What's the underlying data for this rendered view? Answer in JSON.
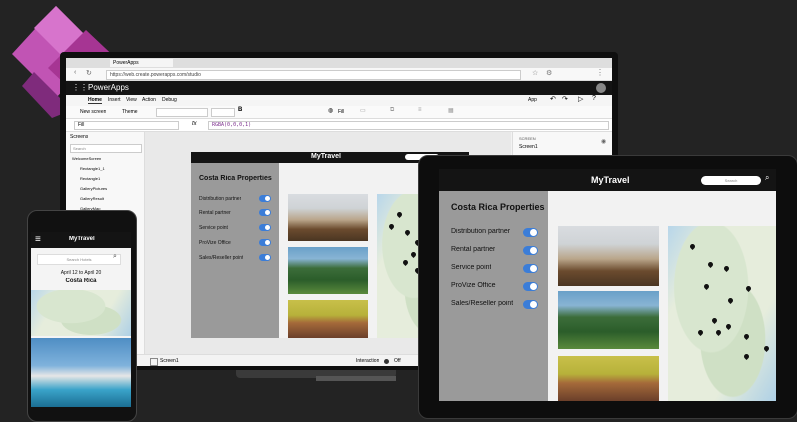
{
  "browser": {
    "tab_title": "PowerApps",
    "url": "https://web.create.powerapps.com/studio"
  },
  "studio": {
    "app_name": "PowerApps",
    "ribbon_tabs": [
      "Home",
      "Insert",
      "View",
      "Action",
      "Debug"
    ],
    "app_label": "App",
    "new_screen": "New screen",
    "theme": "Theme",
    "fill": "Fill",
    "property": "Fill",
    "fx": "fx",
    "formula": "RGBA(0,0,0,1)",
    "tree_title": "Screens",
    "search_placeholder": "Search",
    "tree_items": [
      "WelcomeScreen",
      "Rectangle1_1",
      "Rectangle1",
      "GalleryPictures",
      "GalleryResult",
      "GalleryMap"
    ],
    "right_panel_title": "SCREEN",
    "right_panel_item": "Screen1",
    "status_screen": "Screen1",
    "status_interaction": "Interaction",
    "status_off": "Off"
  },
  "app": {
    "title": "MyTravel",
    "section": "Costa Rica Properties",
    "toggles": [
      "Distribution partner",
      "Rental partner",
      "Service point",
      "ProVize Office",
      "Sales/Reseller point"
    ],
    "search_placeholder": "Search",
    "search_icon": "search-icon"
  },
  "phone": {
    "title": "MyTravel",
    "search_placeholder": "Search Hotels",
    "dates": "April 12 to April 20",
    "destination": "Costa Rica"
  },
  "colors": {
    "background": "#232323",
    "accent": "#3b7dd8",
    "sidebar": "#9a9a9a",
    "topbar": "#141414",
    "powerapps_purple": "#b43d9b"
  }
}
